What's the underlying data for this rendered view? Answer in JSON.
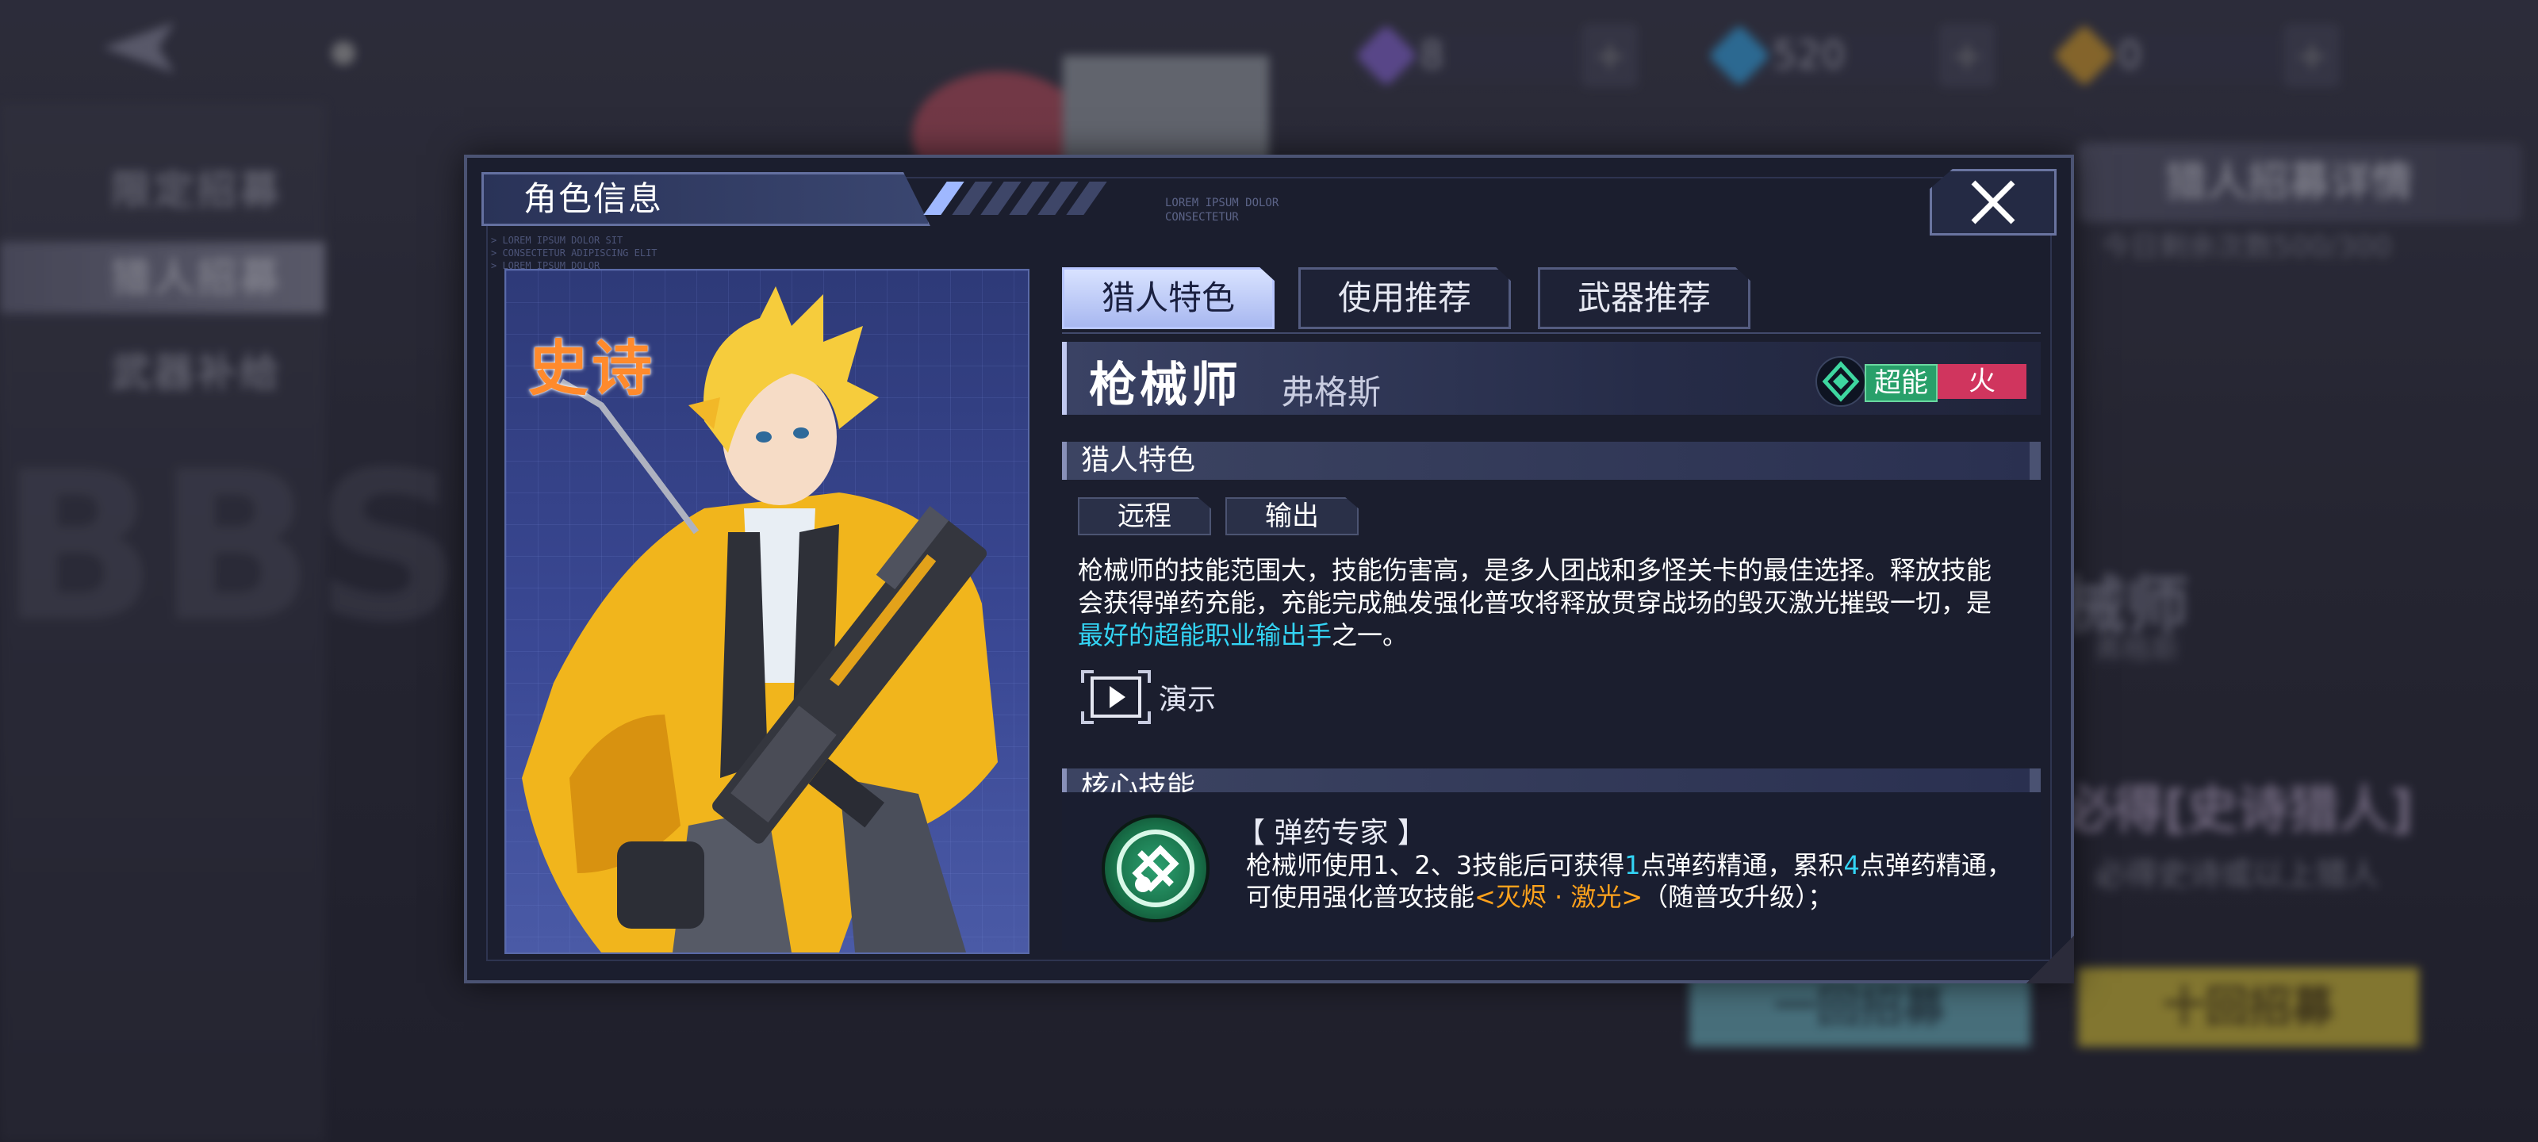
{
  "background": {
    "left_menu": [
      "限定招募",
      "猎人招募",
      "武器补给"
    ],
    "active_menu_index": 1,
    "resources": [
      {
        "icon": "purple-ticket-icon",
        "value": "8",
        "color": "#8a6ad8"
      },
      {
        "icon": "blue-crystal-icon",
        "value": "520",
        "color": "#3aa8e8"
      },
      {
        "icon": "gold-crystal-icon",
        "value": "0",
        "color": "#d8a030"
      }
    ],
    "plus_label": "+",
    "detail_title": "猎人招募详情",
    "detail_sub": "今日剩余次数500/300",
    "side_name": "械师",
    "side_mini": "弗格斯",
    "promo": "必得[史诗猎人]",
    "promo_sub": "必得史诗或以上猎人",
    "pull_once": "一回招募",
    "pull_ten": "十回招募"
  },
  "modal": {
    "title": "角色信息",
    "lorem_top": "LOREM IPSUM DOLOR\nCONSECTETUR",
    "lorem_left": "> LOREM IPSUM DOLOR SIT\n> CONSECTETUR ADIPISCING ELIT\n> LOREM IPSUM DOLOR",
    "rarity": "史诗",
    "tabs": [
      "猎人特色",
      "使用推荐",
      "武器推荐"
    ],
    "active_tab": 0,
    "character": {
      "name": "枪械师",
      "codename": "弗格斯",
      "type_badge": "超能",
      "element_badge": "火",
      "type_color": "#28a06a",
      "element_color": "#d0355e"
    },
    "features": {
      "heading": "猎人特色",
      "tags": [
        "远程",
        "输出"
      ],
      "desc_1": "枪械师的技能范围大，技能伤害高，是多人团战和多怪关卡的最佳选择。释放技能会获得弹药充能，充能完成触发强化普攻将释放贯穿战场的毁灭激光摧毁一切，是",
      "desc_highlight": "最好的超能职业输出手",
      "desc_2": "之一。",
      "demo_label": "演示"
    },
    "core_skill": {
      "heading": "核心技能",
      "name": "【 弹药专家 】",
      "desc_a": "枪械师使用1、2、3技能后可获得",
      "num_1": "1",
      "desc_b": "点弹药精通，累积",
      "num_4": "4",
      "desc_c": "点弹药精通，可使用强化普攻技能",
      "skill_ref": "<灭烬 · 激光>",
      "desc_d": "（随普攻升级）；"
    }
  }
}
